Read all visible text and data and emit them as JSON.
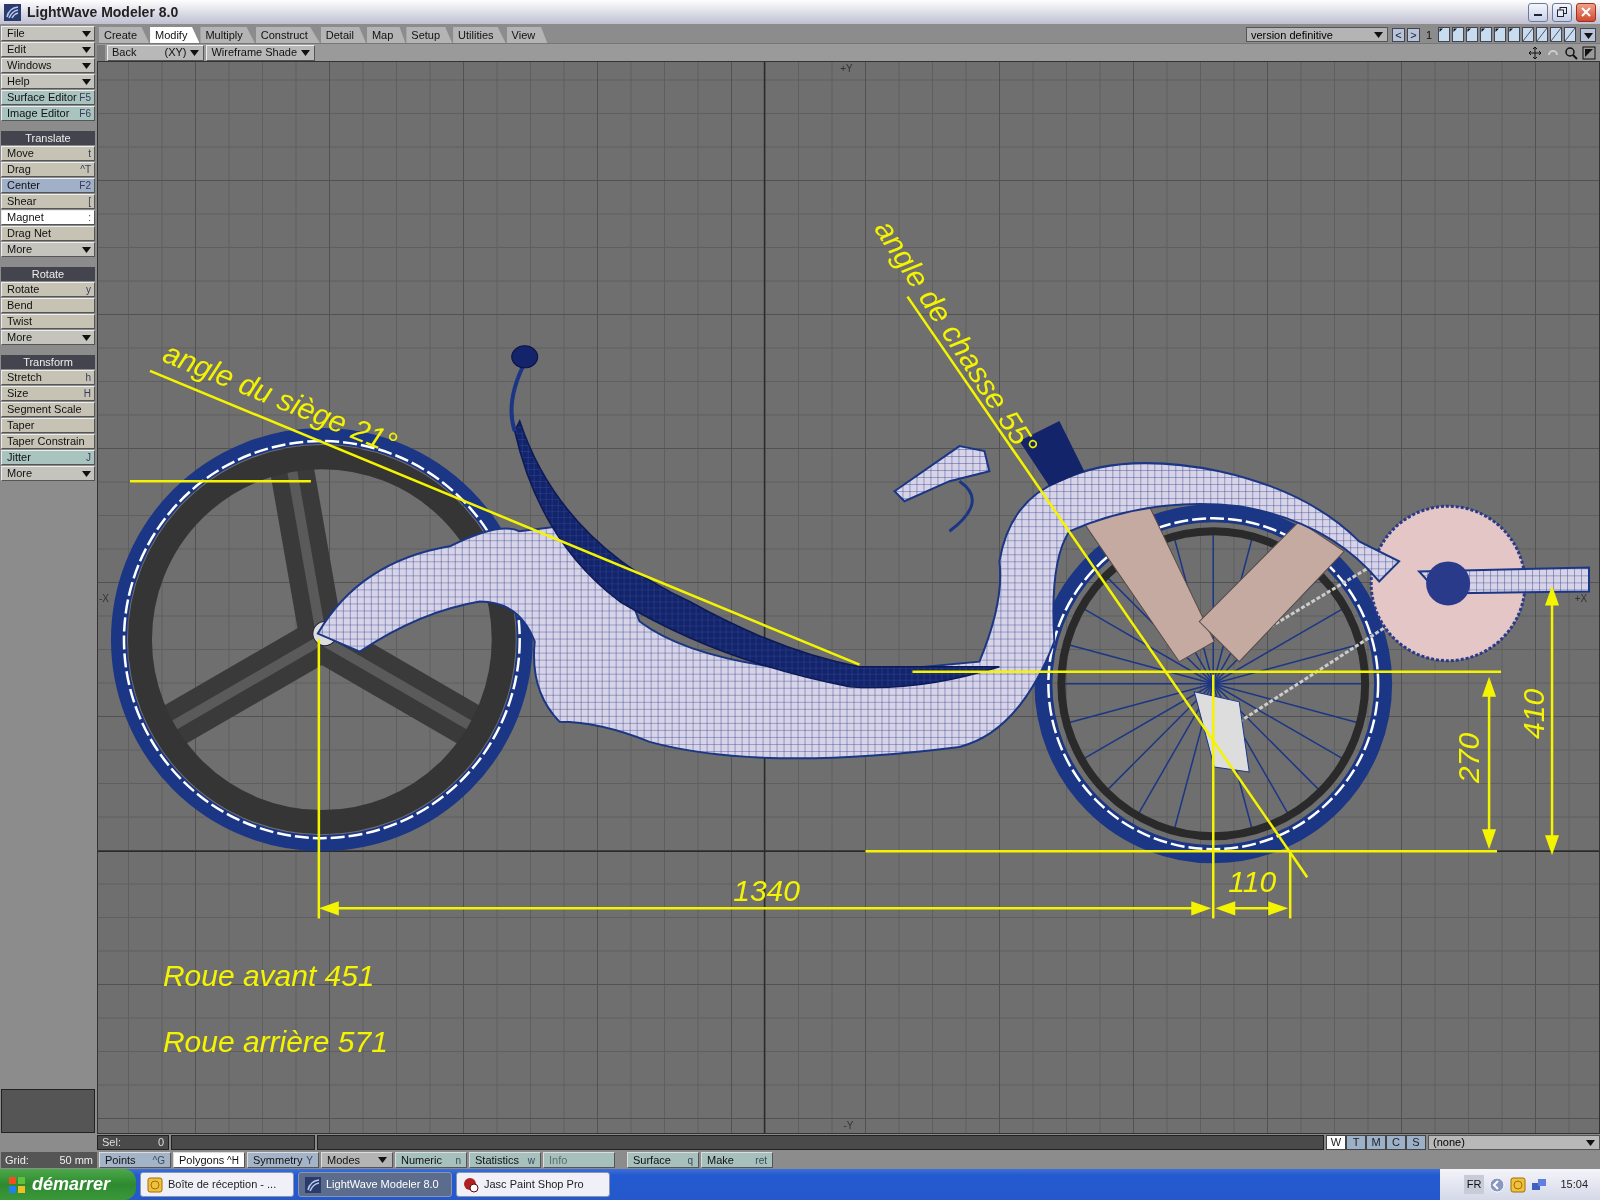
{
  "window": {
    "title": "LightWave Modeler 8.0"
  },
  "menus": [
    {
      "label": "File",
      "kind": "dropdown",
      "color": "#c4c4bc"
    },
    {
      "label": "Edit",
      "kind": "dropdown",
      "color": "#c4c4bc"
    },
    {
      "label": "Windows",
      "kind": "dropdown",
      "color": "#c4c4bc"
    },
    {
      "label": "Help",
      "kind": "dropdown",
      "color": "#c4c4bc"
    },
    {
      "label": "Surface Editor",
      "kind": "command",
      "shortcut": "F5",
      "color": "#a9c3bf"
    },
    {
      "label": "Image Editor",
      "kind": "command",
      "shortcut": "F6",
      "color": "#a9c3bf"
    }
  ],
  "tool_groups": [
    {
      "title": "Translate",
      "items": [
        {
          "label": "Move",
          "kind": "command",
          "shortcut": "t",
          "color": "#c6c2b4",
          "selected": false
        },
        {
          "label": "Drag",
          "kind": "command",
          "shortcut": "^T",
          "color": "#c6c2b4",
          "selected": false
        },
        {
          "label": "Center",
          "kind": "command",
          "shortcut": "F2",
          "color": "#9fb0c8",
          "selected": false
        },
        {
          "label": "Shear",
          "kind": "command",
          "shortcut": "[",
          "color": "#c6c2b4",
          "selected": false
        },
        {
          "label": "Magnet",
          "kind": "command",
          "shortcut": ":",
          "selected": true
        },
        {
          "label": "Drag Net",
          "kind": "command",
          "color": "#c6c2b4",
          "selected": false
        },
        {
          "label": "More",
          "kind": "dropdown",
          "color": "#c4c4bc",
          "selected": false
        }
      ]
    },
    {
      "title": "Rotate",
      "items": [
        {
          "label": "Rotate",
          "kind": "command",
          "shortcut": "y",
          "color": "#c6c2b4",
          "selected": false
        },
        {
          "label": "Bend",
          "kind": "command",
          "color": "#c6c2b4",
          "selected": false
        },
        {
          "label": "Twist",
          "kind": "command",
          "color": "#c6c2b4",
          "selected": false
        },
        {
          "label": "More",
          "kind": "dropdown",
          "color": "#c4c4bc",
          "selected": false
        }
      ]
    },
    {
      "title": "Transform",
      "items": [
        {
          "label": "Stretch",
          "kind": "command",
          "shortcut": "h",
          "color": "#c6c2b4",
          "selected": false
        },
        {
          "label": "Size",
          "kind": "command",
          "shortcut": "H",
          "color": "#c6c2b4",
          "selected": false
        },
        {
          "label": "Segment Scale",
          "kind": "command",
          "color": "#c6c2b4",
          "selected": false
        },
        {
          "label": "Taper",
          "kind": "command",
          "color": "#c6c2b4",
          "selected": false
        },
        {
          "label": "Taper Constrain",
          "kind": "command",
          "color": "#c6c2b4",
          "selected": false
        },
        {
          "label": "Jitter",
          "kind": "command",
          "shortcut": "J",
          "color": "#a9c3bf",
          "selected": false
        },
        {
          "label": "More",
          "kind": "dropdown",
          "color": "#c4c4bc",
          "selected": false
        }
      ]
    }
  ],
  "tabs": [
    {
      "label": "Create",
      "selected": false
    },
    {
      "label": "Modify",
      "selected": true
    },
    {
      "label": "Multiply",
      "selected": false
    },
    {
      "label": "Construct",
      "selected": false
    },
    {
      "label": "Detail",
      "selected": false
    },
    {
      "label": "Map",
      "selected": false
    },
    {
      "label": "Setup",
      "selected": false
    },
    {
      "label": "Utilities",
      "selected": false
    },
    {
      "label": "View",
      "selected": false
    }
  ],
  "object_selector": {
    "value": "version definitive",
    "prev": "<",
    "next": ">",
    "layer_number": "1",
    "layers": [
      {
        "foreground": true
      },
      {
        "foreground": true
      },
      {
        "foreground": true
      },
      {
        "foreground": true
      },
      {
        "foreground": true
      },
      {
        "foreground": true
      },
      {
        "foreground": false
      },
      {
        "foreground": false
      },
      {
        "foreground": false
      },
      {
        "foreground": false
      }
    ]
  },
  "view_bar": {
    "view": "Back",
    "axes": "(XY)",
    "shading": "Wireframe Shade"
  },
  "viewport": {
    "axis_labels": [
      "+Y",
      "-X",
      "+X",
      "-Y"
    ],
    "annotations": [
      {
        "kind": "seat-angle",
        "text": "angle du siège 21°"
      },
      {
        "kind": "head-angle",
        "text": "angle de chasse 55°"
      },
      {
        "kind": "wheelbase",
        "text": "1340"
      },
      {
        "kind": "trail",
        "text": "110"
      },
      {
        "kind": "seat-height",
        "text": "270"
      },
      {
        "kind": "crank-height",
        "text": "410"
      },
      {
        "kind": "note",
        "text": "Roue avant 451"
      },
      {
        "kind": "note",
        "text": "Roue arrière 571"
      }
    ]
  },
  "status": {
    "sel_label": "Sel:",
    "sel_value": "0",
    "views": [
      {
        "label": "W",
        "selected": true
      },
      {
        "label": "T",
        "selected": false
      },
      {
        "label": "M",
        "selected": false
      },
      {
        "label": "C",
        "selected": false
      },
      {
        "label": "S",
        "selected": false
      }
    ],
    "surface": "(none)"
  },
  "toolbar": {
    "grid_label": "Grid:",
    "grid_value": "50 mm",
    "buttons": [
      {
        "label": "Points",
        "shortcut": "^G",
        "kind": "toggle",
        "selected": false
      },
      {
        "label": "Polygons",
        "shortcut": "^H",
        "kind": "toggle",
        "selected": true
      },
      {
        "label": "Symmetry",
        "shortcut": "Y",
        "kind": "toggle",
        "selected": false
      },
      {
        "label": "Modes",
        "kind": "dropdown"
      },
      {
        "label": "Numeric",
        "shortcut": "n",
        "kind": "command",
        "disabled": false
      },
      {
        "label": "Statistics",
        "shortcut": "w",
        "kind": "command",
        "disabled": false
      },
      {
        "label": "Info",
        "kind": "command",
        "disabled": true
      },
      {
        "label": "Surface",
        "shortcut": "q",
        "kind": "command",
        "disabled": false
      },
      {
        "label": "Make",
        "shortcut": "ret",
        "kind": "command",
        "disabled": false
      }
    ]
  },
  "taskbar": {
    "start": "démarrer",
    "tasks": [
      {
        "label": "Boîte de réception - ...",
        "selected": false
      },
      {
        "label": "LightWave Modeler 8.0",
        "selected": true
      },
      {
        "label": "Jasc Paint Shop Pro",
        "selected": false
      }
    ],
    "language": "FR",
    "clock": "15:04"
  }
}
